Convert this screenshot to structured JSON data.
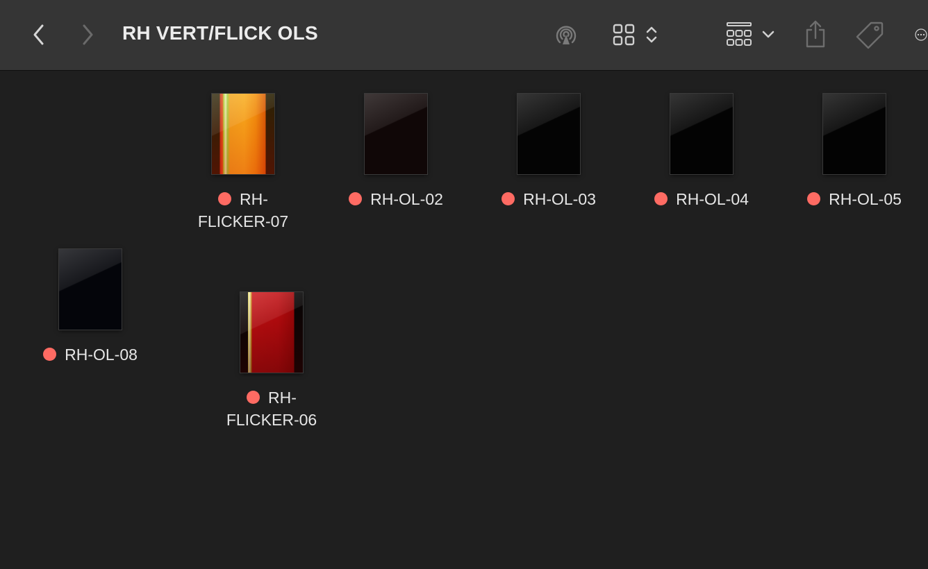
{
  "window": {
    "title": "RH VERT/FLICK OLS"
  },
  "toolbar": {
    "back_icon": "chevron-left-icon",
    "forward_icon": "chevron-right-icon",
    "airdrop_icon": "airdrop-icon",
    "view_icon": "grid-view-icon",
    "view_toggle_icon": "up-down-chevron-icon",
    "group_icon": "group-by-icon",
    "group_menu_icon": "chevron-down-icon",
    "share_icon": "share-icon",
    "tag_icon": "tag-icon",
    "more_icon": "ellipsis-circle-icon"
  },
  "colors": {
    "tag_red": "#fe6b63",
    "toolbar_bg": "#353535",
    "content_bg": "#1f1f1f"
  },
  "files": [
    {
      "line1": "RH-",
      "line2": "FLICKER-07",
      "tag": "red"
    },
    {
      "line1": "RH-OL-02",
      "line2": "",
      "tag": "red"
    },
    {
      "line1": "RH-OL-03",
      "line2": "",
      "tag": "red"
    },
    {
      "line1": "RH-OL-04",
      "line2": "",
      "tag": "red"
    },
    {
      "line1": "RH-OL-05",
      "line2": "",
      "tag": "red"
    },
    {
      "line1": "RH-OL-08",
      "line2": "",
      "tag": "red"
    },
    {
      "line1": "RH-",
      "line2": "FLICKER-06",
      "tag": "red"
    }
  ]
}
